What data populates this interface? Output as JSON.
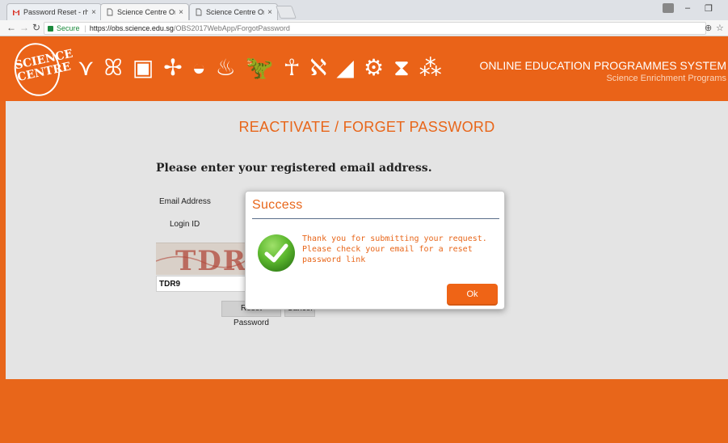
{
  "browser": {
    "tabs": [
      {
        "label": "Password Reset - rhaiza",
        "icon": "gmail-icon"
      },
      {
        "label": "Science Centre Online B",
        "icon": "page-icon"
      },
      {
        "label": "Science Centre Online B",
        "icon": "page-icon"
      }
    ],
    "close_glyph": "×",
    "omnibox": {
      "secure_label": "Secure",
      "url_host": "https://obs.science.edu.sg",
      "url_path": "/OBS2017WebApp/ForgotPassword"
    }
  },
  "banner": {
    "logo_text": "SCIENCE CENTRE",
    "system_title": "ONLINE EDUCATION PROGRAMMES SYSTEM",
    "system_subtitle": "Science Enrichment Programs"
  },
  "form": {
    "heading": "REACTIVATE / FORGET PASSWORD",
    "instruction": "Please enter your registered email address.",
    "email_label": "Email Address",
    "login_label": "Login ID",
    "captcha_image_text": "TDR",
    "captcha_value": "TDR9",
    "reset_label": "Reset Password",
    "cancel_label": "Cancel"
  },
  "modal": {
    "title": "Success",
    "message_line1": "Thank you for submitting your request.",
    "message_line2": "Please check your email for a reset",
    "message_line3": "password link",
    "ok_label": "Ok",
    "accent_color": "#e8661a",
    "check_color": "#5cb82e"
  }
}
